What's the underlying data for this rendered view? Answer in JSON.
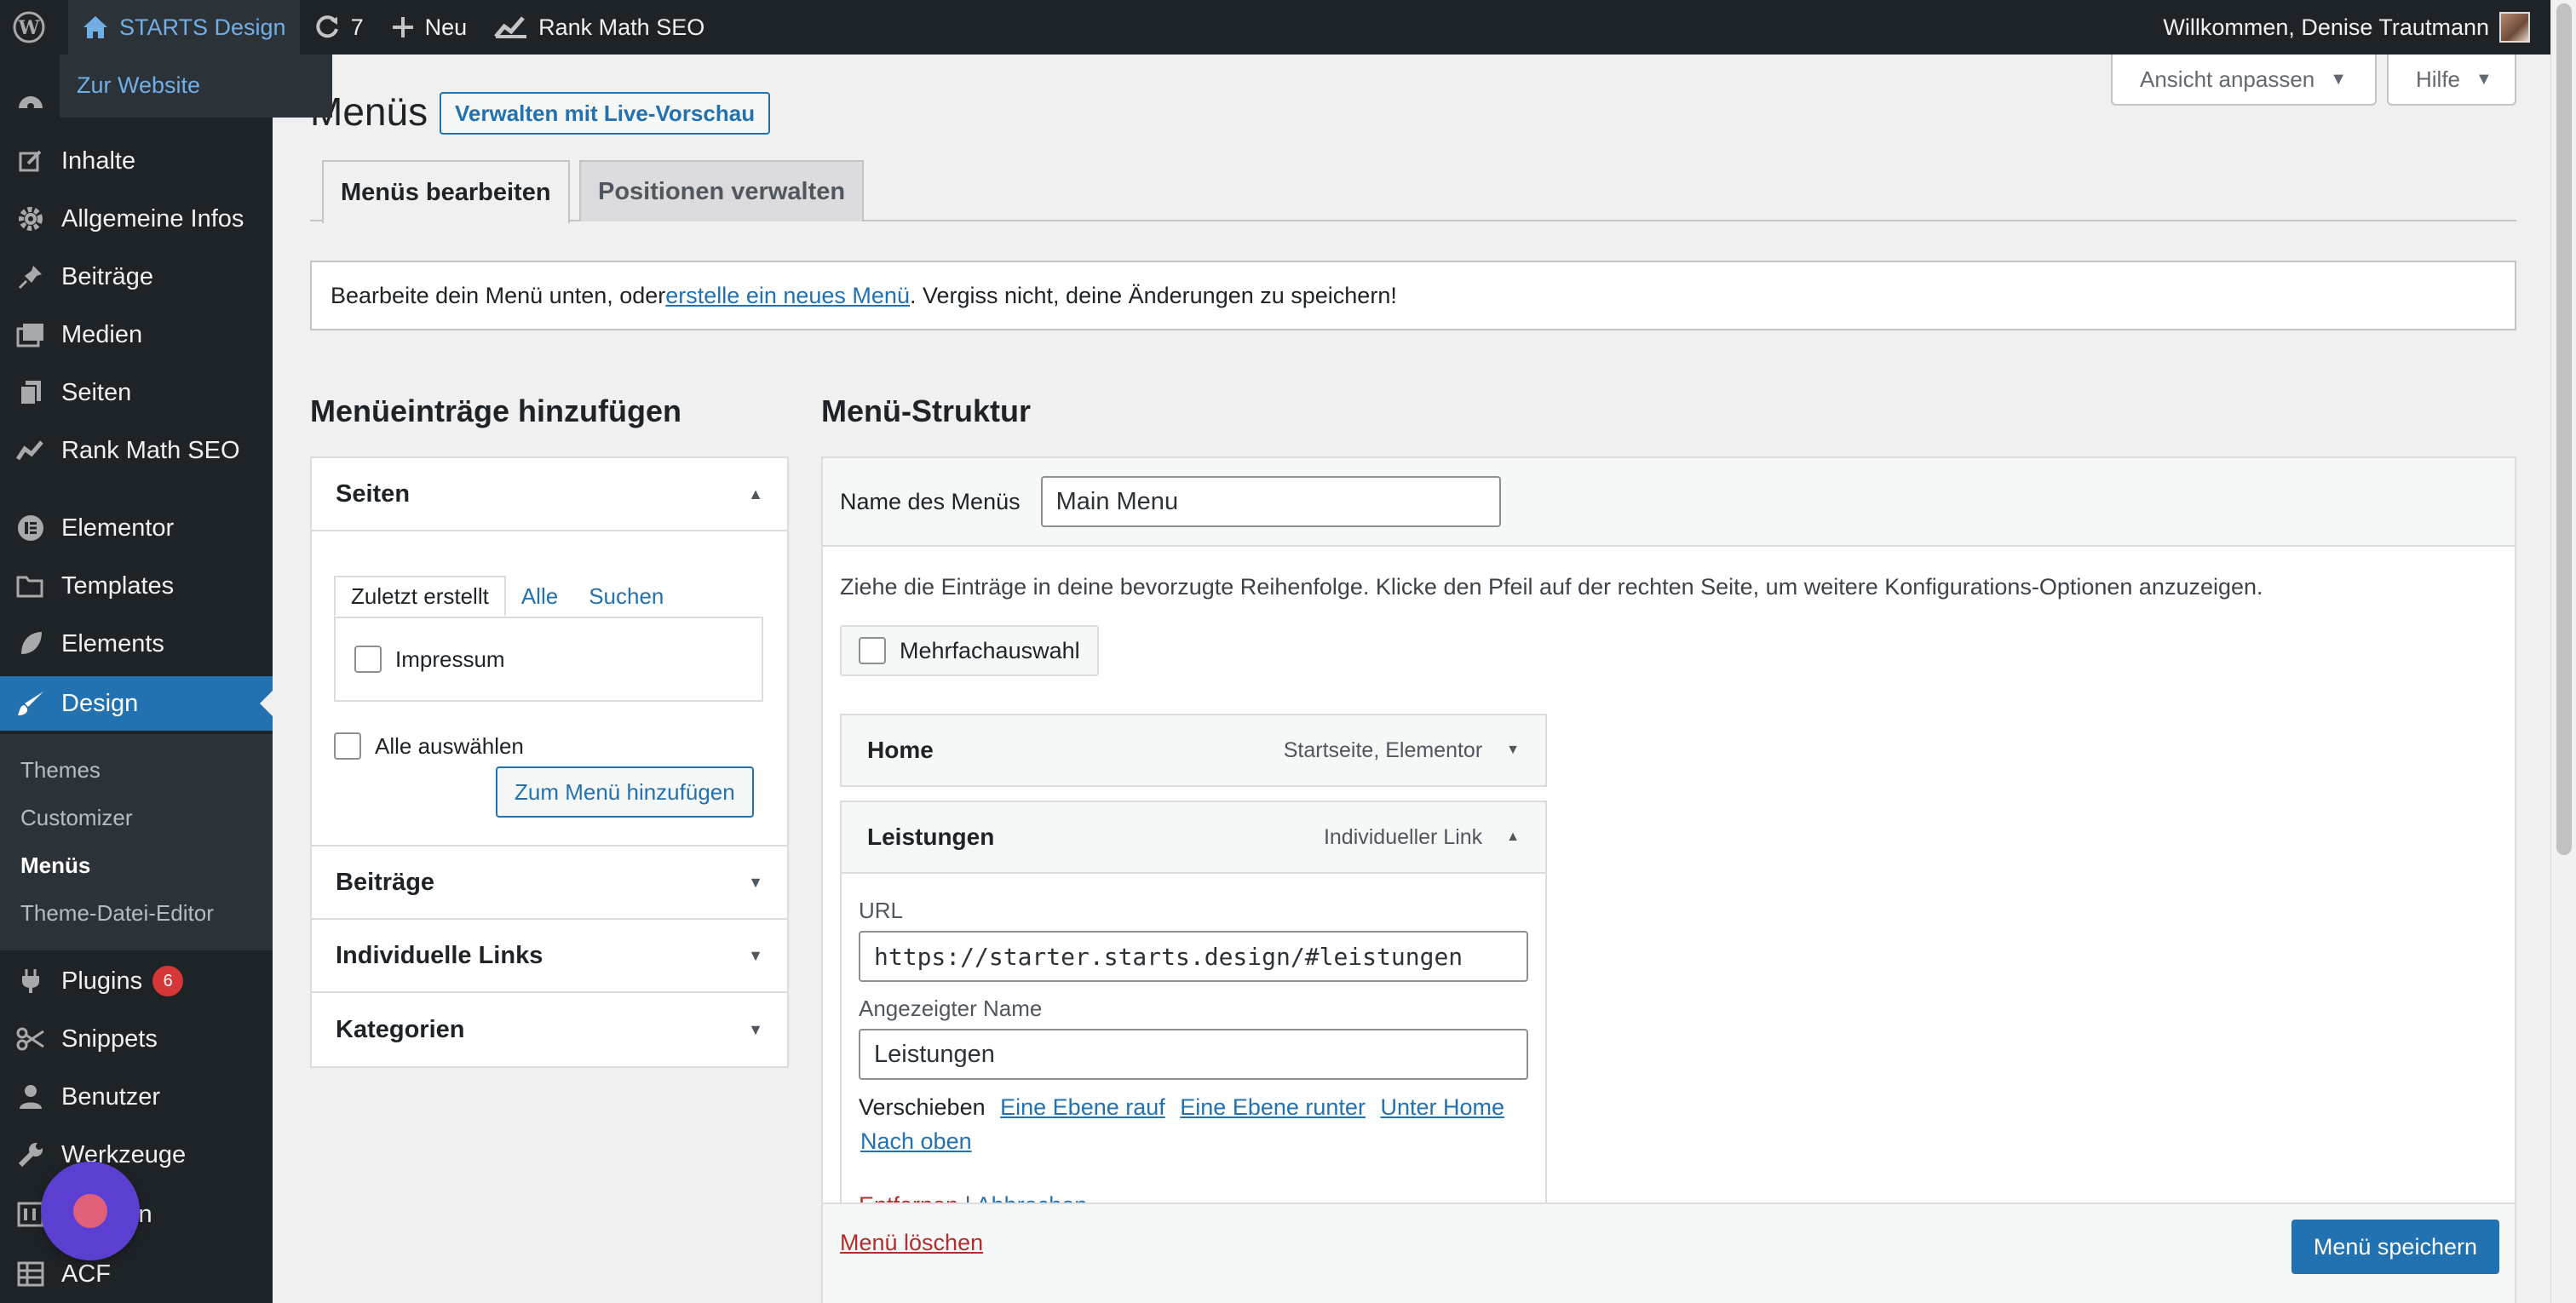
{
  "adminbar": {
    "site_name": "STARTS Design",
    "updates_count": "7",
    "new_label": "Neu",
    "rankmath_label": "Rank Math SEO",
    "greeting": "Willkommen, Denise Trautmann",
    "site_dropdown_link": "Zur Website"
  },
  "sidebar": {
    "items": [
      {
        "label": "Inhalte",
        "icon": "edit-icon"
      },
      {
        "label": "Allgemeine Infos",
        "icon": "gear-icon"
      },
      {
        "label": "Beiträge",
        "icon": "pin-icon"
      },
      {
        "label": "Medien",
        "icon": "media-icon"
      },
      {
        "label": "Seiten",
        "icon": "pages-icon"
      },
      {
        "label": "Rank Math SEO",
        "icon": "rankmath-icon"
      },
      {
        "label": "Elementor",
        "icon": "elementor-icon"
      },
      {
        "label": "Templates",
        "icon": "folder-icon"
      },
      {
        "label": "Elements",
        "icon": "leaf-icon"
      },
      {
        "label": "Design",
        "icon": "brush-icon"
      },
      {
        "label": "Plugins",
        "icon": "plug-icon",
        "badge": "6"
      },
      {
        "label": "Snippets",
        "icon": "scissors-icon"
      },
      {
        "label": "Benutzer",
        "icon": "user-icon"
      },
      {
        "label": "Werkzeuge",
        "icon": "wrench-icon"
      },
      {
        "label": "ungen",
        "icon": "settings-icon"
      },
      {
        "label": "ACF",
        "icon": "grid-icon"
      }
    ],
    "submenu": [
      "Themes",
      "Customizer",
      "Menüs",
      "Theme-Datei-Editor"
    ]
  },
  "header": {
    "screen_options": "Ansicht anpassen",
    "help": "Hilfe",
    "title": "Menüs",
    "live_preview": "Verwalten mit Live-Vorschau"
  },
  "tabs": [
    "Menüs bearbeiten",
    "Positionen verwalten"
  ],
  "notice": {
    "before": "Bearbeite dein Menü unten, oder ",
    "link": "erstelle ein neues Menü",
    "after": ". Vergiss nicht, deine Änderungen zu speichern!"
  },
  "add_items": {
    "heading": "Menüeinträge hinzufügen",
    "pages_section": "Seiten",
    "inner_tabs": [
      "Zuletzt erstellt",
      "Alle",
      "Suchen"
    ],
    "page_item": "Impressum",
    "select_all": "Alle auswählen",
    "add_button": "Zum Menü hinzufügen",
    "other_sections": [
      "Beiträge",
      "Individuelle Links",
      "Kategorien"
    ]
  },
  "structure": {
    "heading": "Menü-Struktur",
    "name_label": "Name des Menüs",
    "name_value": "Main Menu",
    "instructions": "Ziehe die Einträge in deine bevorzugte Reihenfolge. Klicke den Pfeil auf der rechten Seite, um weitere Konfigurations-Optionen anzuzeigen.",
    "bulk_select": "Mehrfachauswahl",
    "items": [
      {
        "title": "Home",
        "type": "Startseite, Elementor"
      },
      {
        "title": "Leistungen",
        "type": "Individueller Link"
      }
    ],
    "url_label": "URL",
    "url_value": "https://starter.starts.design/#leistungen",
    "nav_label_label": "Angezeigter Name",
    "nav_label_value": "Leistungen",
    "move_label": "Verschieben",
    "move_links": [
      "Eine Ebene rauf",
      "Eine Ebene runter",
      "Unter Home",
      "Nach oben"
    ],
    "remove_link": "Entfernen",
    "separator": "|",
    "cancel_link": "Abbrechen",
    "delete_menu": "Menü löschen",
    "save_button": "Menü speichern"
  }
}
